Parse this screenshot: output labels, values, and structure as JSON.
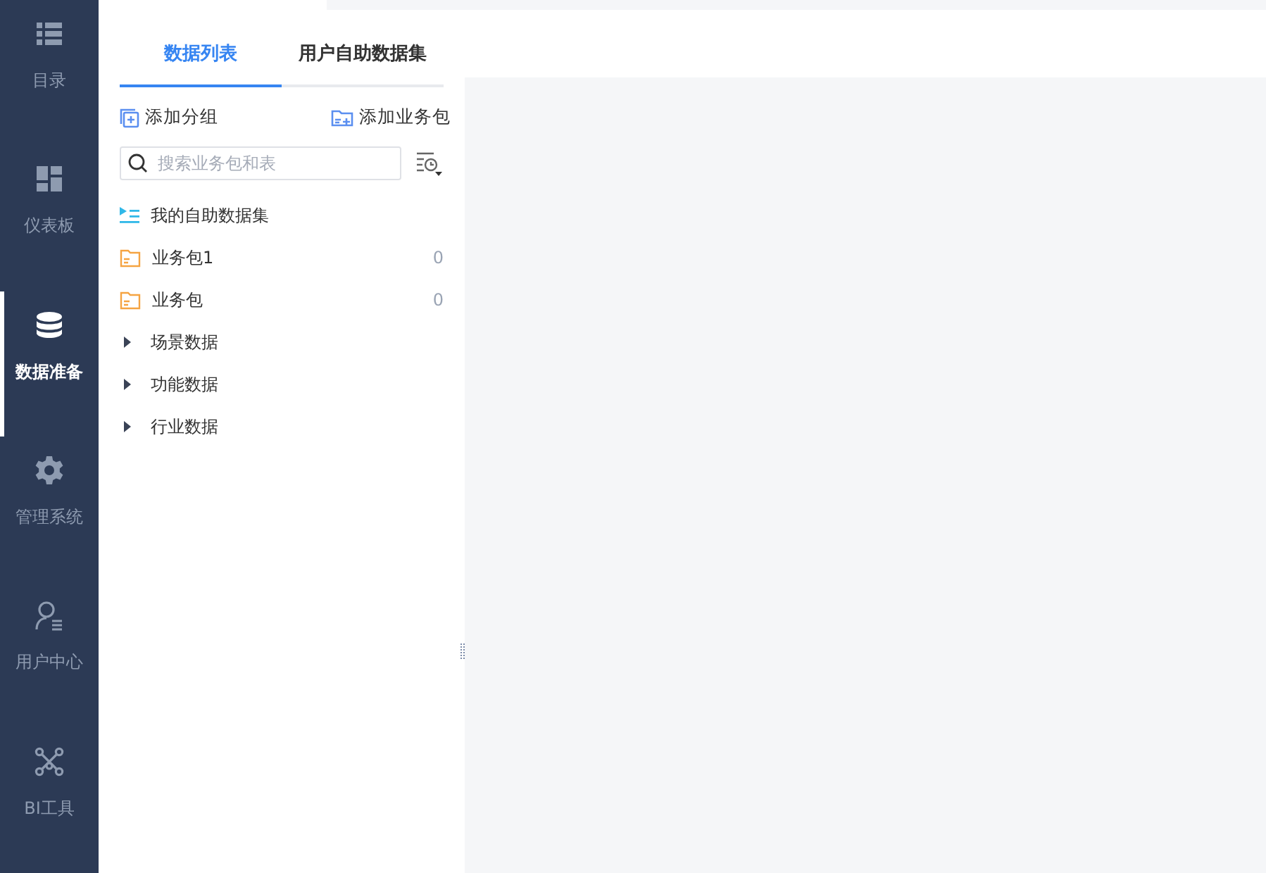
{
  "sidebar": {
    "items": [
      {
        "label": "目录",
        "selected": false
      },
      {
        "label": "仪表板",
        "selected": false
      },
      {
        "label": "数据准备",
        "selected": true
      },
      {
        "label": "管理系统",
        "selected": false
      },
      {
        "label": "用户中心",
        "selected": false
      },
      {
        "label": "BI工具",
        "selected": false
      }
    ]
  },
  "tabs": [
    {
      "label": "数据列表",
      "selected": true
    },
    {
      "label": "用户自助数据集",
      "selected": false
    }
  ],
  "actions": [
    {
      "label": "添加分组"
    },
    {
      "label": "添加业务包"
    }
  ],
  "search": {
    "placeholder": "搜索业务包和表"
  },
  "tree": [
    {
      "kind": "dataset",
      "label": "我的自助数据集"
    },
    {
      "kind": "folder",
      "label": "业务包1",
      "count": "0"
    },
    {
      "kind": "folder",
      "label": "业务包",
      "count": "0"
    },
    {
      "kind": "group",
      "label": "场景数据",
      "expanded": false
    },
    {
      "kind": "group",
      "label": "功能数据",
      "expanded": false
    },
    {
      "kind": "group",
      "label": "行业数据",
      "expanded": false
    }
  ]
}
